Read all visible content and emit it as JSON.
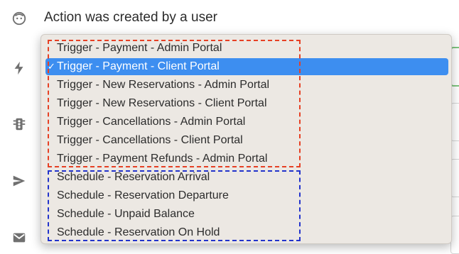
{
  "header": {
    "title": "Action was created by a user"
  },
  "sidebar": {
    "icons": [
      "face-icon",
      "bolt-icon",
      "traffic-light-icon",
      "send-icon",
      "mail-icon"
    ]
  },
  "dropdown": {
    "selected": "Trigger - Payment - Client Portal",
    "checkmark": "✓",
    "trigger_group": [
      "Trigger - Payment - Admin Portal",
      "Trigger - Payment - Client Portal",
      "Trigger - New Reservations - Admin Portal",
      "Trigger - New Reservations - Client Portal",
      "Trigger - Cancellations - Admin Portal",
      "Trigger - Cancellations - Client Portal",
      "Trigger - Payment Refunds - Admin Portal"
    ],
    "schedule_group": [
      "Schedule - Reservation Arrival",
      "Schedule - Reservation Departure",
      "Schedule - Unpaid Balance",
      "Schedule - Reservation On Hold"
    ]
  },
  "colors": {
    "selected_bg": "#3d8ef0",
    "trigger_box": "#e64024",
    "schedule_box": "#2233cc",
    "menu_bg": "#ece8e3"
  }
}
